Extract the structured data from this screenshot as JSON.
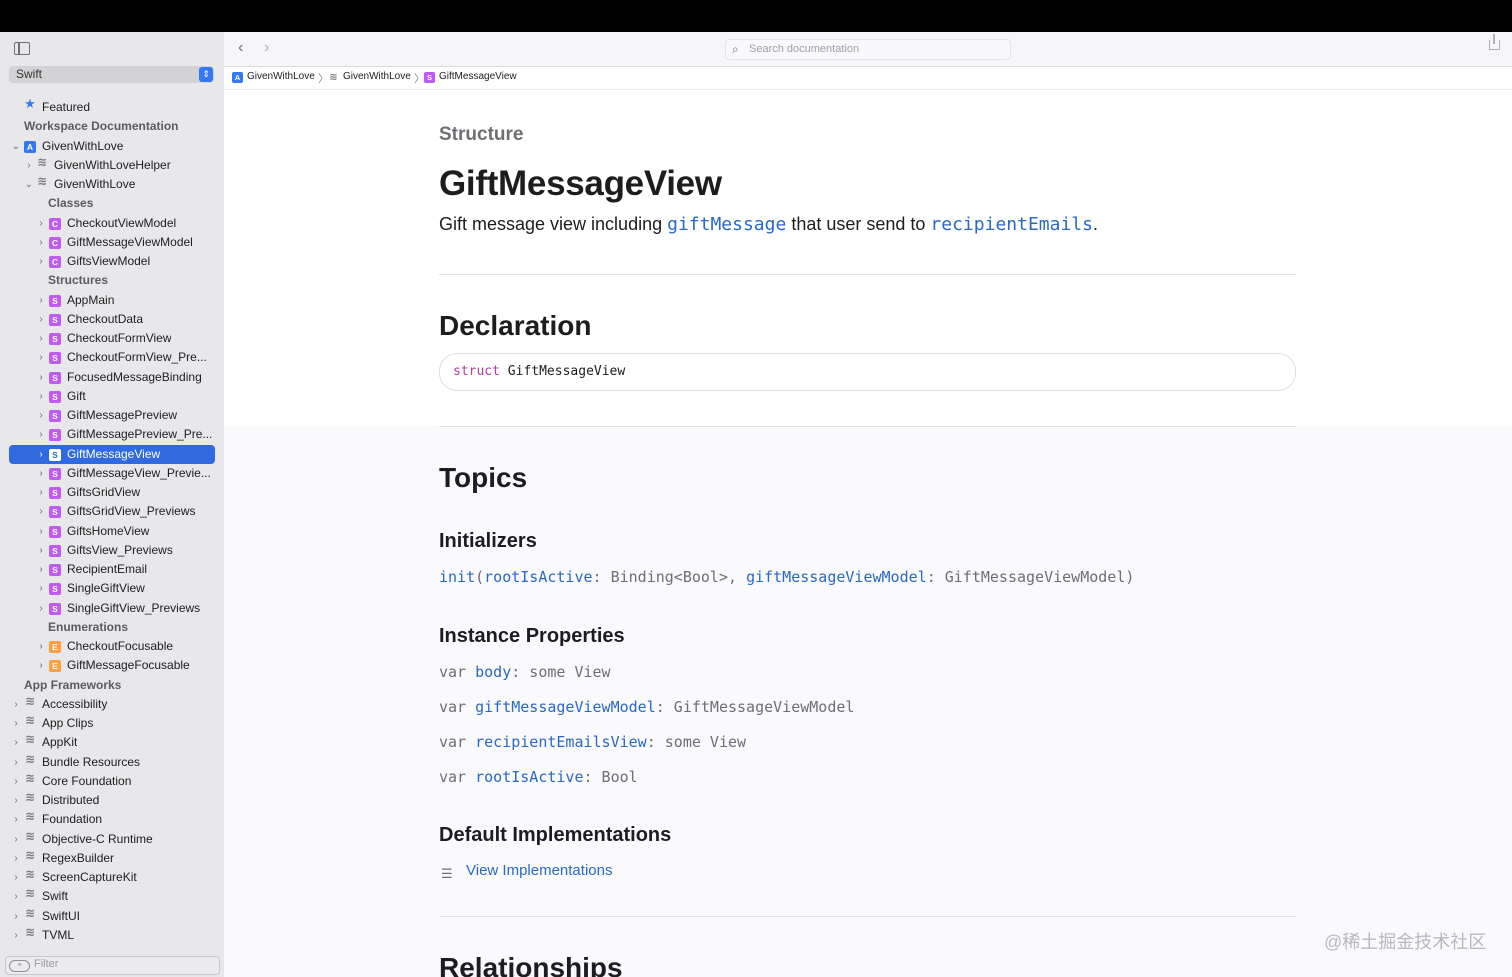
{
  "sidebar": {
    "language": "Swift",
    "filter_placeholder": "Filter",
    "rows": [
      {
        "label": "Featured",
        "icon": "star",
        "chev": "",
        "level": 1,
        "header": false
      },
      {
        "label": "Workspace Documentation",
        "icon": "",
        "chev": "",
        "level": 1,
        "header": true
      },
      {
        "label": "GivenWithLove",
        "icon": "app",
        "chev": "down",
        "level": 1,
        "header": false
      },
      {
        "label": "GivenWithLoveHelper",
        "icon": "framework",
        "chev": "right",
        "level": 2,
        "header": false
      },
      {
        "label": "GivenWithLove",
        "icon": "framework",
        "chev": "down",
        "level": 2,
        "header": false
      },
      {
        "label": "Classes",
        "icon": "",
        "chev": "",
        "level": 3,
        "header": true
      },
      {
        "label": "CheckoutViewModel",
        "icon": "C",
        "chev": "right",
        "level": 3,
        "header": false
      },
      {
        "label": "GiftMessageViewModel",
        "icon": "C",
        "chev": "right",
        "level": 3,
        "header": false
      },
      {
        "label": "GiftsViewModel",
        "icon": "C",
        "chev": "right",
        "level": 3,
        "header": false
      },
      {
        "label": "Structures",
        "icon": "",
        "chev": "",
        "level": 3,
        "header": true
      },
      {
        "label": "AppMain",
        "icon": "S",
        "chev": "right",
        "level": 3,
        "header": false
      },
      {
        "label": "CheckoutData",
        "icon": "S",
        "chev": "right",
        "level": 3,
        "header": false
      },
      {
        "label": "CheckoutFormView",
        "icon": "S",
        "chev": "right",
        "level": 3,
        "header": false
      },
      {
        "label": "CheckoutFormView_Pre...",
        "icon": "S",
        "chev": "right",
        "level": 3,
        "header": false
      },
      {
        "label": "FocusedMessageBinding",
        "icon": "S",
        "chev": "right",
        "level": 3,
        "header": false
      },
      {
        "label": "Gift",
        "icon": "S",
        "chev": "right",
        "level": 3,
        "header": false
      },
      {
        "label": "GiftMessagePreview",
        "icon": "S",
        "chev": "right",
        "level": 3,
        "header": false
      },
      {
        "label": "GiftMessagePreview_Pre...",
        "icon": "S",
        "chev": "right",
        "level": 3,
        "header": false
      },
      {
        "label": "GiftMessageView",
        "icon": "S",
        "chev": "right",
        "level": 3,
        "header": false,
        "selected": true
      },
      {
        "label": "GiftMessageView_Previe...",
        "icon": "S",
        "chev": "right",
        "level": 3,
        "header": false
      },
      {
        "label": "GiftsGridView",
        "icon": "S",
        "chev": "right",
        "level": 3,
        "header": false
      },
      {
        "label": "GiftsGridView_Previews",
        "icon": "S",
        "chev": "right",
        "level": 3,
        "header": false
      },
      {
        "label": "GiftsHomeView",
        "icon": "S",
        "chev": "right",
        "level": 3,
        "header": false
      },
      {
        "label": "GiftsView_Previews",
        "icon": "S",
        "chev": "right",
        "level": 3,
        "header": false
      },
      {
        "label": "RecipientEmail",
        "icon": "S",
        "chev": "right",
        "level": 3,
        "header": false
      },
      {
        "label": "SingleGiftView",
        "icon": "S",
        "chev": "right",
        "level": 3,
        "header": false
      },
      {
        "label": "SingleGiftView_Previews",
        "icon": "S",
        "chev": "right",
        "level": 3,
        "header": false
      },
      {
        "label": "Enumerations",
        "icon": "",
        "chev": "",
        "level": 3,
        "header": true
      },
      {
        "label": "CheckoutFocusable",
        "icon": "E",
        "chev": "right",
        "level": 3,
        "header": false
      },
      {
        "label": "GiftMessageFocusable",
        "icon": "E",
        "chev": "right",
        "level": 3,
        "header": false
      },
      {
        "label": "App Frameworks",
        "icon": "",
        "chev": "",
        "level": 1,
        "header": true
      },
      {
        "label": "Accessibility",
        "icon": "framework",
        "chev": "right",
        "level": 1,
        "header": false
      },
      {
        "label": "App Clips",
        "icon": "framework",
        "chev": "right",
        "level": 1,
        "header": false
      },
      {
        "label": "AppKit",
        "icon": "framework",
        "chev": "right",
        "level": 1,
        "header": false
      },
      {
        "label": "Bundle Resources",
        "icon": "framework",
        "chev": "right",
        "level": 1,
        "header": false
      },
      {
        "label": "Core Foundation",
        "icon": "framework",
        "chev": "right",
        "level": 1,
        "header": false
      },
      {
        "label": "Distributed",
        "icon": "framework",
        "chev": "right",
        "level": 1,
        "header": false
      },
      {
        "label": "Foundation",
        "icon": "framework",
        "chev": "right",
        "level": 1,
        "header": false
      },
      {
        "label": "Objective-C Runtime",
        "icon": "framework",
        "chev": "right",
        "level": 1,
        "header": false
      },
      {
        "label": "RegexBuilder",
        "icon": "framework",
        "chev": "right",
        "level": 1,
        "header": false
      },
      {
        "label": "ScreenCaptureKit",
        "icon": "framework",
        "chev": "right",
        "level": 1,
        "header": false
      },
      {
        "label": "Swift",
        "icon": "framework",
        "chev": "right",
        "level": 1,
        "header": false
      },
      {
        "label": "SwiftUI",
        "icon": "framework",
        "chev": "right",
        "level": 1,
        "header": false
      },
      {
        "label": "TVML",
        "icon": "framework",
        "chev": "right",
        "level": 1,
        "header": false
      }
    ]
  },
  "toolbar": {
    "search_placeholder": "Search documentation"
  },
  "breadcrumb": [
    {
      "label": "GivenWithLove",
      "icon": "app"
    },
    {
      "label": "GivenWithLove",
      "icon": "framework"
    },
    {
      "label": "GiftMessageView",
      "icon": "S"
    }
  ],
  "doc": {
    "kicker": "Structure",
    "title": "GiftMessageView",
    "abstract": {
      "part1": "Gift message view including ",
      "link1": "giftMessage",
      "part2": " that user send to ",
      "link2": "recipientEmails",
      "part3": "."
    },
    "declaration_heading": "Declaration",
    "declaration": {
      "keyword": "struct",
      "name": "GiftMessageView"
    },
    "topics_heading": "Topics",
    "initializers_heading": "Initializers",
    "initializer": {
      "name": "init",
      "p0": "(",
      "arg1": "rootIsActive",
      "t1": ": Binding<Bool>, ",
      "arg2": "giftMessageViewModel",
      "t2": ": GiftMessageViewModel)"
    },
    "instance_properties_heading": "Instance Properties",
    "properties": [
      {
        "kw": "var ",
        "name": "body",
        "type": ": some View"
      },
      {
        "kw": "var ",
        "name": "giftMessageViewModel",
        "type": ": GiftMessageViewModel"
      },
      {
        "kw": "var ",
        "name": "recipientEmailsView",
        "type": ": some View"
      },
      {
        "kw": "var ",
        "name": "rootIsActive",
        "type": ": Bool"
      }
    ],
    "default_impl_heading": "Default Implementations",
    "view_impl_label": "View Implementations",
    "relationships_heading": "Relationships"
  },
  "watermark": "@稀土掘金技术社区"
}
